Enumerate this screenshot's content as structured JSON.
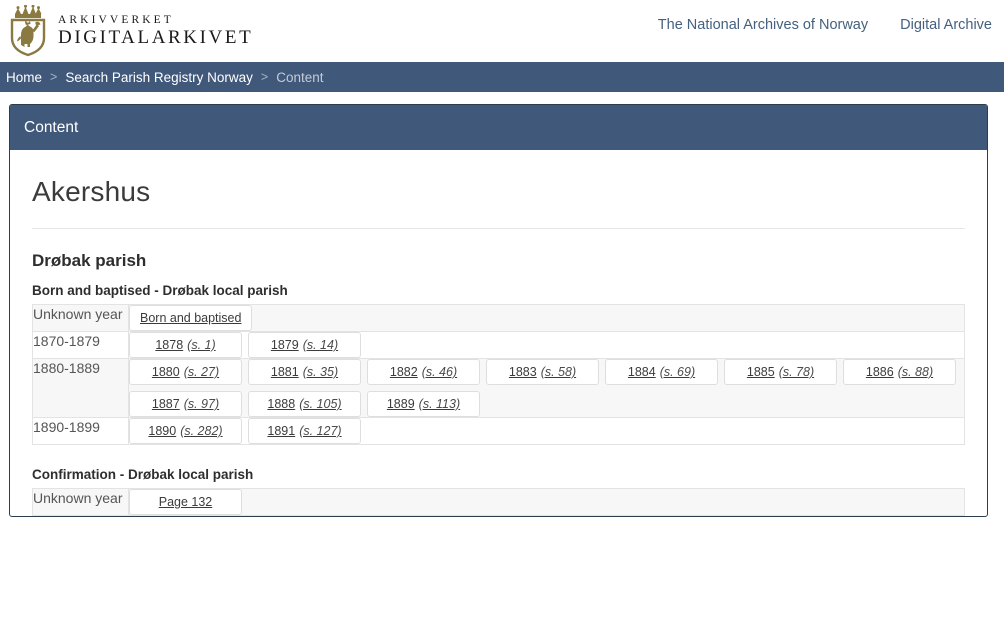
{
  "header": {
    "logo_icon": "norway-coat-of-arms-icon",
    "brand_line1": "ARKIVVERKET",
    "brand_line2": "DIGITALARKIVET",
    "nav": [
      {
        "label": "The National Archives of Norway"
      },
      {
        "label": "Digital Archive"
      }
    ]
  },
  "breadcrumb": {
    "items": [
      {
        "label": "Home",
        "current": false
      },
      {
        "label": "Search Parish Registry Norway",
        "current": false
      },
      {
        "label": "Content",
        "current": true
      }
    ],
    "separator": ">"
  },
  "panel": {
    "title": "Content",
    "region_title": "Akershus",
    "parish_title": "Drøbak parish"
  },
  "sections": [
    {
      "title": "Born and baptised - Drøbak local parish",
      "rows": [
        {
          "year": "Unknown year",
          "items": [
            {
              "main": "Born and baptised",
              "suffix": ""
            }
          ]
        },
        {
          "year": "1870-1879",
          "items": [
            {
              "main": "1878",
              "suffix": "(s. 1)"
            },
            {
              "main": "1879",
              "suffix": "(s. 14)"
            }
          ]
        },
        {
          "year": "1880-1889",
          "items": [
            {
              "main": "1880",
              "suffix": "(s. 27)"
            },
            {
              "main": "1881",
              "suffix": "(s. 35)"
            },
            {
              "main": "1882",
              "suffix": "(s. 46)"
            },
            {
              "main": "1883",
              "suffix": "(s. 58)"
            },
            {
              "main": "1884",
              "suffix": "(s. 69)"
            },
            {
              "main": "1885",
              "suffix": "(s. 78)"
            },
            {
              "main": "1886",
              "suffix": "(s. 88)"
            },
            {
              "main": "1887",
              "suffix": "(s. 97)"
            },
            {
              "main": "1888",
              "suffix": "(s. 105)"
            },
            {
              "main": "1889",
              "suffix": "(s. 113)"
            }
          ]
        },
        {
          "year": "1890-1899",
          "items": [
            {
              "main": "1890",
              "suffix": "(s. 282)"
            },
            {
              "main": "1891",
              "suffix": "(s. 127)"
            }
          ]
        }
      ]
    },
    {
      "title": "Confirmation - Drøbak local parish",
      "rows": [
        {
          "year": "Unknown year",
          "items": [
            {
              "main": "Page 132",
              "suffix": ""
            }
          ]
        }
      ]
    }
  ],
  "colors": {
    "navy": "#40587a",
    "panel_border": "#2c3e4d",
    "crest_gold": "#8a7a42",
    "link": "#44617f",
    "stripe": "#f7f7f7"
  }
}
